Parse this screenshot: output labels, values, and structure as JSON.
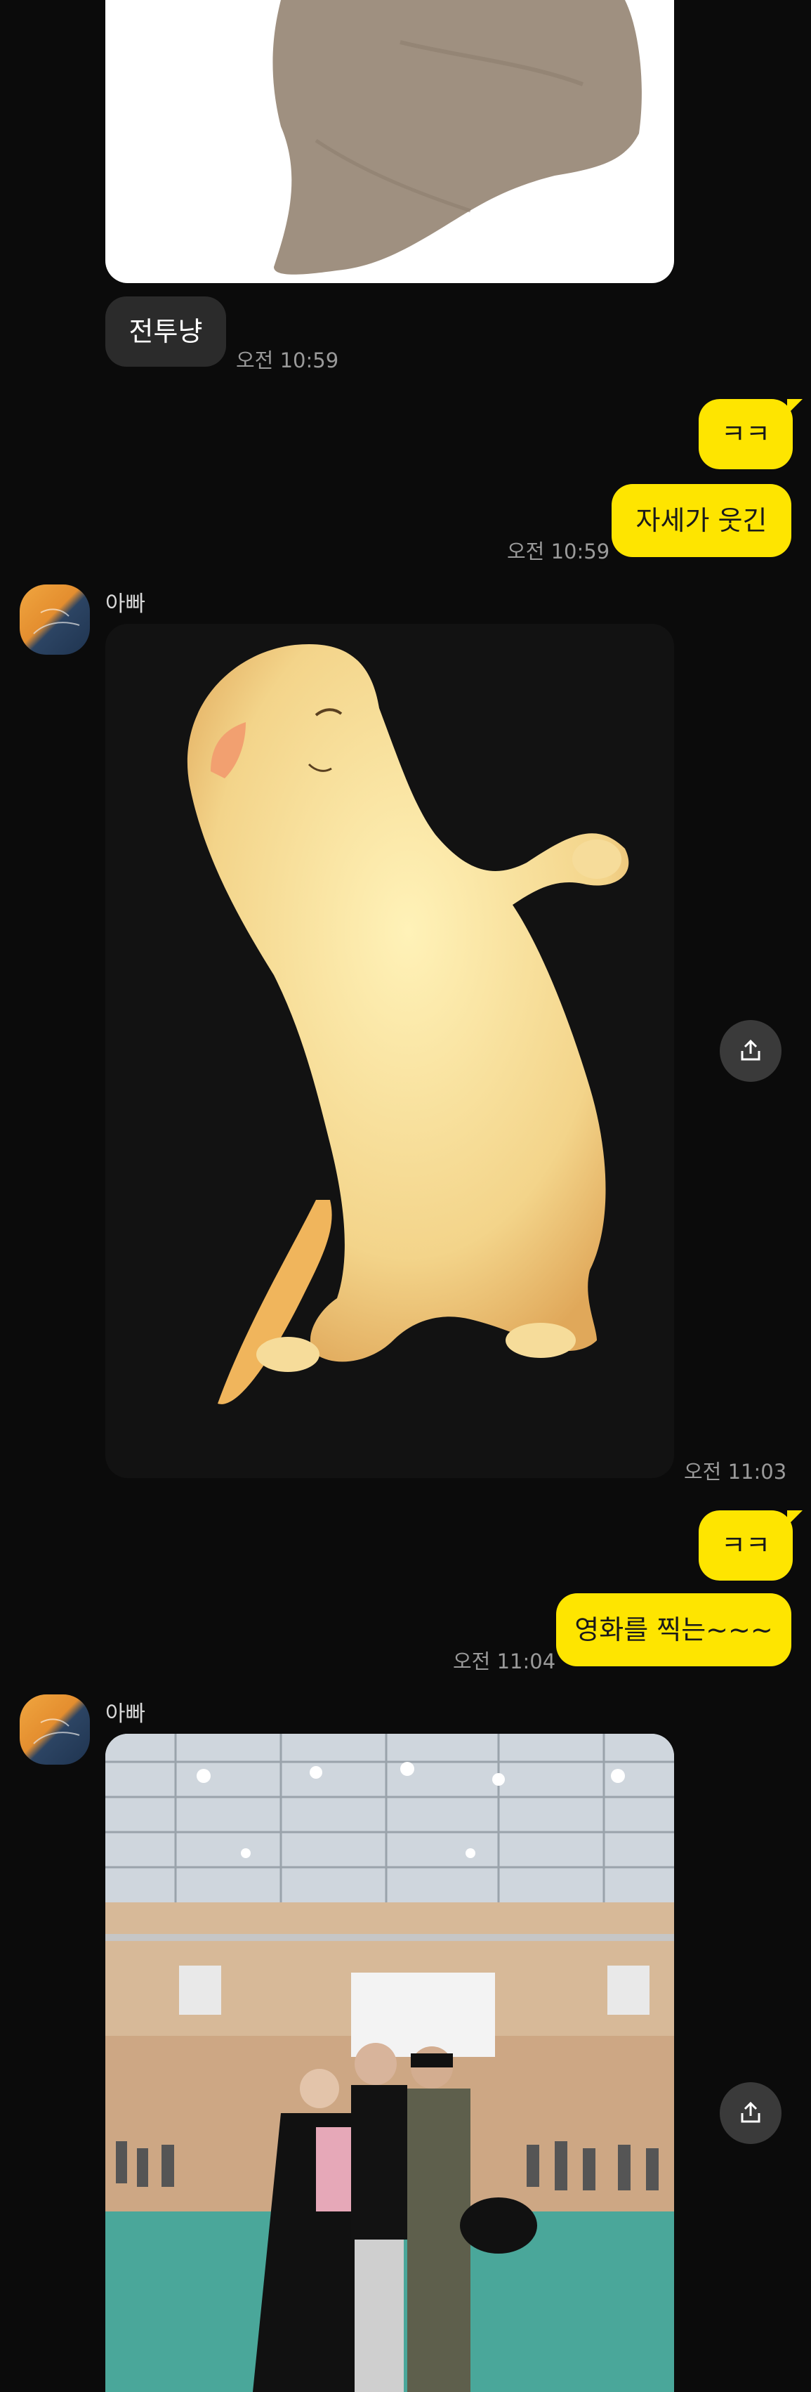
{
  "messages": {
    "m1": {
      "text": "전투냥",
      "time": "오전 10:59"
    },
    "m2": {
      "text": "ㅋㅋ"
    },
    "m3": {
      "text": "자세가 웃긴",
      "time": "오전 10:59"
    },
    "m4": {
      "sender": "아빠",
      "time": "오전 11:03"
    },
    "m5": {
      "text": "ㅋㅋ"
    },
    "m6": {
      "text": "영화를 찍는~~~",
      "time": "오전 11:04"
    },
    "m7": {
      "sender": "아빠"
    }
  },
  "icons": {
    "share": "share-icon",
    "avatar": "avatar"
  },
  "colors": {
    "background": "#0b0b0b",
    "incoming_bubble": "#2b2b2b",
    "outgoing_bubble": "#fee500",
    "timestamp": "#9a9a9a"
  }
}
